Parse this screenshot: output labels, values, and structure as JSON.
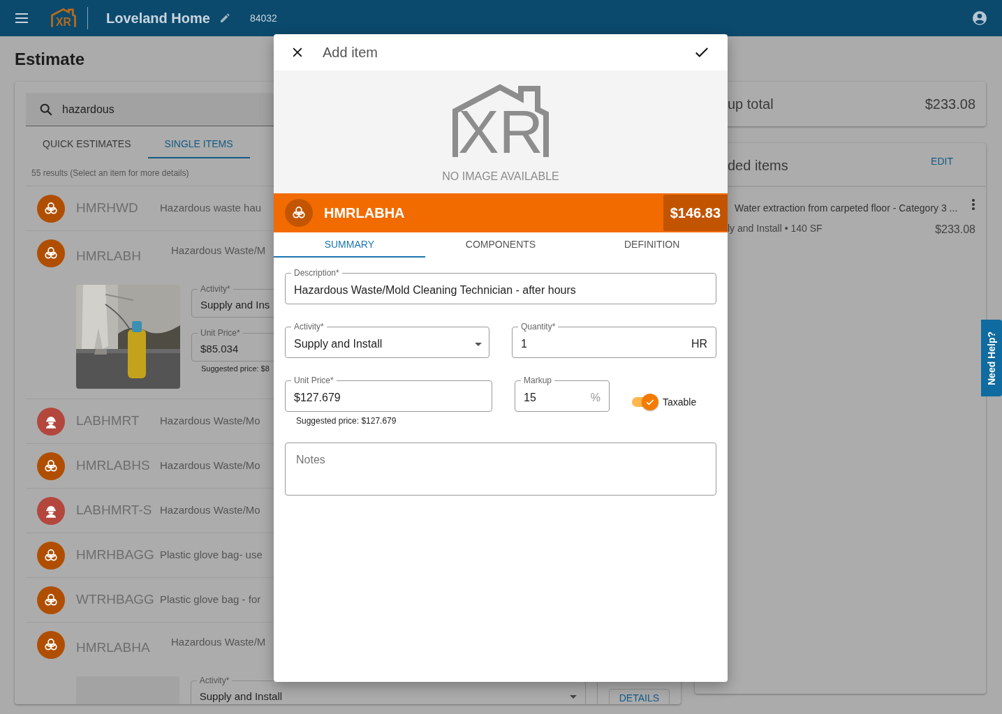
{
  "header": {
    "logo_text": "XR",
    "title": "Loveland Home",
    "job_number": "84032"
  },
  "page_title": "Estimate",
  "search": {
    "value": "hazardous"
  },
  "search_tabs": [
    {
      "label": "QUICK ESTIMATES",
      "selected": false
    },
    {
      "label": "SINGLE ITEMS",
      "selected": true
    }
  ],
  "results_note": "55 results (Select an item for more details)",
  "results": [
    {
      "kind": "hazard",
      "code": "HMRHWD",
      "description": "Hazardous waste hau",
      "expanded": false
    },
    {
      "kind": "hazard",
      "code": "HMRLABH",
      "description": "Hazardous Waste/M",
      "expanded": true,
      "details": {
        "fields": [
          {
            "kind": "text",
            "label": "Activity*",
            "value": "Supply and Ins"
          },
          {
            "kind": "text",
            "label": "Unit Price*",
            "value": "$85.034"
          }
        ],
        "suggested": "Suggested price: $8"
      }
    },
    {
      "kind": "labor",
      "code": "LABHMRT",
      "description": "Hazardous Waste/Mo",
      "expanded": false
    },
    {
      "kind": "hazard",
      "code": "HMRLABHS",
      "description": "Hazardous Waste/Mo",
      "expanded": false
    },
    {
      "kind": "labor",
      "code": "LABHMRT-S",
      "description": "Hazardous Waste/Mo",
      "expanded": false
    },
    {
      "kind": "hazard",
      "code": "HMRHBAGG",
      "description": "Plastic glove bag- use",
      "expanded": false
    },
    {
      "kind": "hazard",
      "code": "WTRHBAGG",
      "description": "Plastic glove bag - for",
      "expanded": false
    },
    {
      "kind": "hazard",
      "code": "HMRLABHA",
      "description": "Hazardous Waste/M",
      "expanded": true,
      "details": {
        "image": {
          "kind": "blank"
        },
        "fields": [
          {
            "kind": "select",
            "label": "Activity*",
            "value": "Supply and Install"
          }
        ],
        "button": "DETAILS"
      }
    }
  ],
  "group_total": {
    "label": "up total",
    "value": "$233.08"
  },
  "added_items": {
    "title": "ded items",
    "action": "EDIT",
    "items": [
      {
        "name": "Water extraction from carpeted floor - Category 3 ...",
        "detail": "ly and Install • 140 SF",
        "price": "$233.08"
      }
    ]
  },
  "help_tab": "Need Help?",
  "modal": {
    "title": "Add item",
    "logo_text": "XR",
    "image_note": "NO IMAGE AVAILABLE",
    "item": {
      "kind": "hazard",
      "code": "HMRLABHA",
      "price": "$146.83"
    },
    "tabs": [
      {
        "label": "SUMMARY",
        "selected": true
      },
      {
        "label": "COMPONENTS",
        "selected": false
      },
      {
        "label": "DEFINITION",
        "selected": false
      }
    ],
    "description": {
      "label": "Description*",
      "value": "Hazardous Waste/Mold Cleaning Technician - after hours"
    },
    "activity": {
      "label": "Activity*",
      "value": "Supply and Install"
    },
    "quantity": {
      "label": "Quantity*",
      "value": "1",
      "unit": "HR"
    },
    "unit_price": {
      "label": "Unit Price*",
      "value": "$127.679"
    },
    "suggested": "Suggested price: $127.679",
    "markup": {
      "label": "Markup",
      "value": "15",
      "unit": "%"
    },
    "taxable": {
      "label": "Taxable",
      "on": true
    },
    "notes": {
      "placeholder": "Notes"
    }
  }
}
